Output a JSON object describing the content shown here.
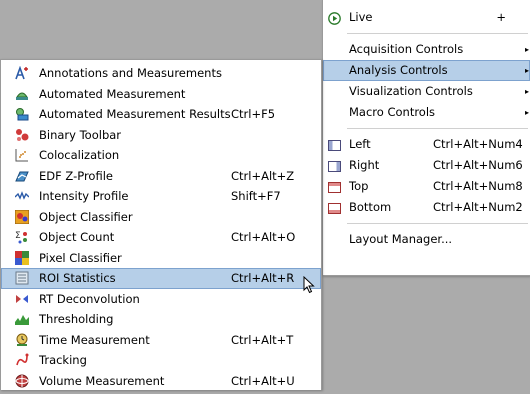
{
  "main_menu": {
    "live": {
      "label": "Live",
      "plus": "+"
    },
    "items": [
      {
        "label": "Acquisition Controls",
        "arrow": "▸"
      },
      {
        "label": "Analysis Controls",
        "arrow": "▸"
      },
      {
        "label": "Visualization Controls",
        "arrow": "▸"
      },
      {
        "label": "Macro Controls",
        "arrow": "▸"
      }
    ],
    "layout": [
      {
        "label": "Left",
        "shortcut": "Ctrl+Alt+Num4"
      },
      {
        "label": "Right",
        "shortcut": "Ctrl+Alt+Num6"
      },
      {
        "label": "Top",
        "shortcut": "Ctrl+Alt+Num8"
      },
      {
        "label": "Bottom",
        "shortcut": "Ctrl+Alt+Num2"
      }
    ],
    "layout_manager": "Layout Manager..."
  },
  "analysis_menu": {
    "items": [
      {
        "label": "Annotations and Measurements",
        "shortcut": ""
      },
      {
        "label": "Automated Measurement",
        "shortcut": ""
      },
      {
        "label": "Automated Measurement Results",
        "shortcut": "Ctrl+F5"
      },
      {
        "label": "Binary Toolbar",
        "shortcut": ""
      },
      {
        "label": "Colocalization",
        "shortcut": ""
      },
      {
        "label": "EDF Z-Profile",
        "shortcut": "Ctrl+Alt+Z"
      },
      {
        "label": "Intensity Profile",
        "shortcut": "Shift+F7"
      },
      {
        "label": "Object Classifier",
        "shortcut": ""
      },
      {
        "label": "Object Count",
        "shortcut": "Ctrl+Alt+O"
      },
      {
        "label": "Pixel Classifier",
        "shortcut": ""
      },
      {
        "label": "ROI Statistics",
        "shortcut": "Ctrl+Alt+R"
      },
      {
        "label": "RT Deconvolution",
        "shortcut": ""
      },
      {
        "label": "Thresholding",
        "shortcut": ""
      },
      {
        "label": "Time Measurement",
        "shortcut": "Ctrl+Alt+T"
      },
      {
        "label": "Tracking",
        "shortcut": ""
      },
      {
        "label": "Volume Measurement",
        "shortcut": "Ctrl+Alt+U"
      }
    ]
  },
  "colors": {
    "highlight": "#b6cfe8",
    "highlight_border": "#7da2ce",
    "background": "#ababab"
  }
}
